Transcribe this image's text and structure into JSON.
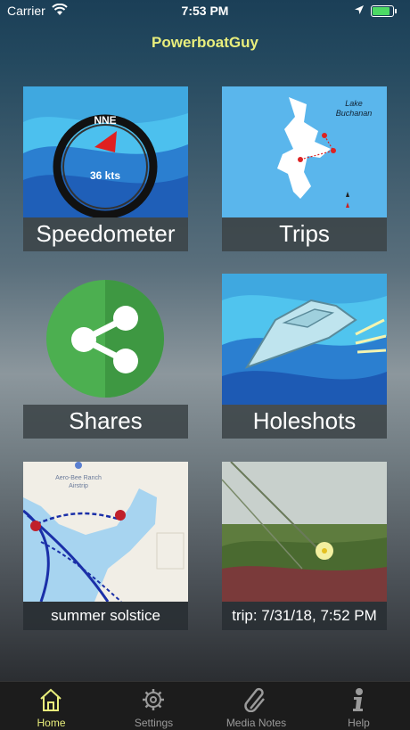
{
  "status_bar": {
    "carrier": "Carrier",
    "time": "7:53 PM"
  },
  "nav": {
    "title": "PowerboatGuy"
  },
  "tiles": [
    {
      "label": "Speedometer",
      "heading": "NNE",
      "speed": "36 kts"
    },
    {
      "label": "Trips",
      "map_label_1": "Lake",
      "map_label_2": "Buchanan"
    },
    {
      "label": "Shares"
    },
    {
      "label": "Holeshots"
    },
    {
      "label": "summer solstice",
      "map_label_1": "Aero-Bee Ranch",
      "map_label_2": "Airstrip"
    },
    {
      "label": "trip: 7/31/18, 7:52 PM"
    }
  ],
  "tabs": [
    {
      "label": "Home",
      "icon": "home-icon",
      "active": true
    },
    {
      "label": "Settings",
      "icon": "gear-icon"
    },
    {
      "label": "Media Notes",
      "icon": "paperclip-icon"
    },
    {
      "label": "Help",
      "icon": "info-icon"
    }
  ],
  "colors": {
    "accent": "#e9ee7c",
    "share_green": "#4caf50"
  }
}
